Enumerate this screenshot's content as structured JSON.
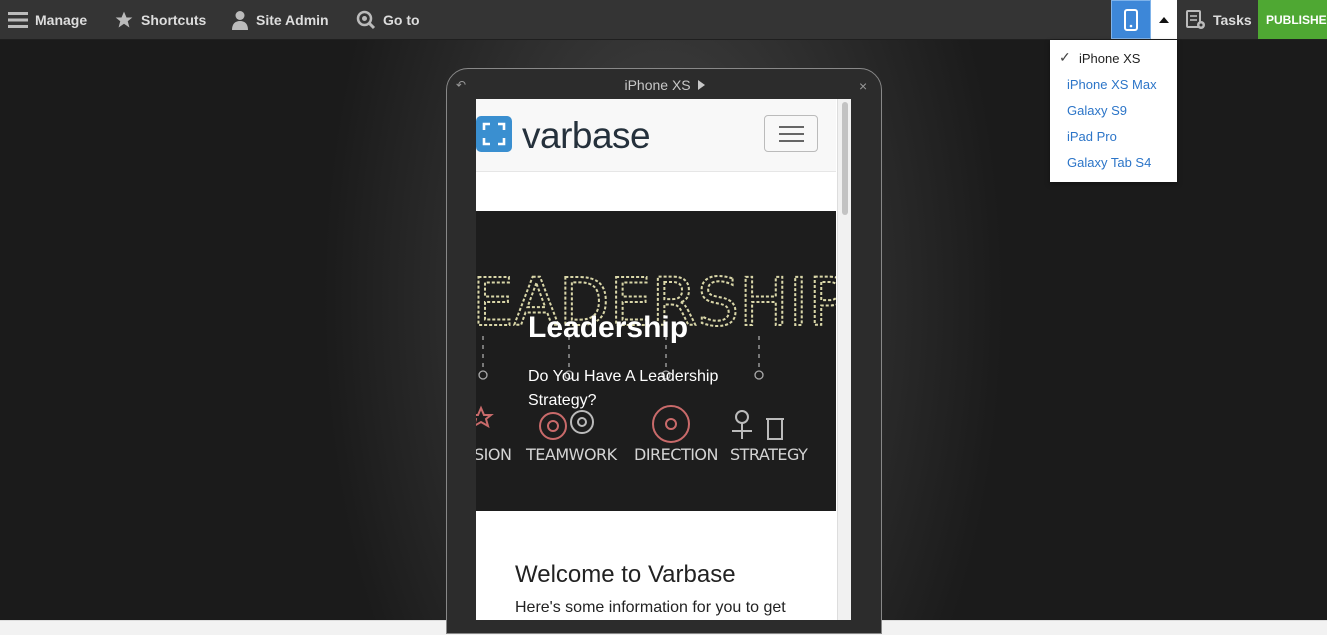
{
  "toolbar": {
    "manage": "Manage",
    "shortcuts": "Shortcuts",
    "site_admin": "Site Admin",
    "goto": "Go to",
    "tasks": "Tasks",
    "published": "PUBLISHED"
  },
  "devices": {
    "selected": "iPhone XS",
    "check": "✓",
    "items": [
      "iPhone XS Max",
      "Galaxy S9",
      "iPad Pro",
      "Galaxy Tab S4"
    ]
  },
  "preview": {
    "title": "iPhone XS",
    "logo": "varbase",
    "hero_image_text": {
      "headline": "EADERSHIP",
      "labels": [
        "SION",
        "TEAMWORK",
        "DIRECTION",
        "STRATEGY"
      ]
    },
    "hero_title": "Leadership",
    "hero_subtitle": "Do You Have A Leadership Strategy?",
    "welcome": "Welcome to Varbase",
    "info": "Here's some information for you to get"
  },
  "colors": {
    "accent_blue": "#3d87d8",
    "published_green": "#4fa833",
    "link_blue": "#2c75c8",
    "logo_blue": "#3a8fd0"
  }
}
